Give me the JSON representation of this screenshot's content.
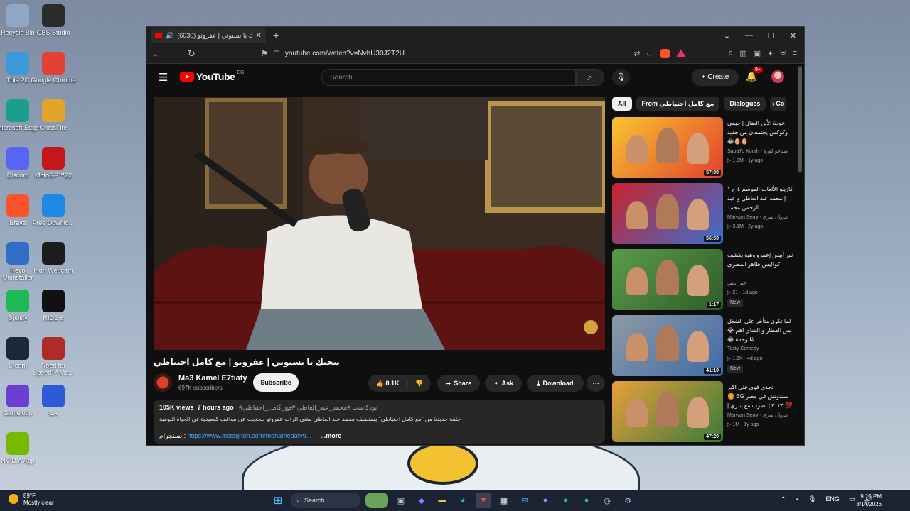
{
  "desktop": {
    "icons": [
      {
        "label": "Recycle Bin",
        "icon": "recycle-bin-icon",
        "color": "#8fa6c4"
      },
      {
        "label": "OBS Studio",
        "icon": "obs-icon",
        "color": "#2b2b2b"
      },
      {
        "label": "This PC",
        "icon": "pc-icon",
        "color": "#3a9ad9"
      },
      {
        "label": "Google Chrome",
        "icon": "chrome-icon",
        "color": "#e34133"
      },
      {
        "label": "Microsoft Edge",
        "icon": "edge-icon",
        "color": "#1a9e8e"
      },
      {
        "label": "CrossFire",
        "icon": "crossfire-icon",
        "color": "#e2a52b"
      },
      {
        "label": "Discord",
        "icon": "discord-icon",
        "color": "#5865f2"
      },
      {
        "label": "MotoGP™22",
        "icon": "motogp-icon",
        "color": "#c5161c"
      },
      {
        "label": "Brave",
        "icon": "brave-icon",
        "color": "#fb542b"
      },
      {
        "label": "Free Downlo...",
        "icon": "free-download-icon",
        "color": "#1e88e5"
      },
      {
        "label": "Revo Uninstaller",
        "icon": "revo-icon",
        "color": "#2f6ec7"
      },
      {
        "label": "Iriun Webcam",
        "icon": "webcam-icon",
        "color": "#1d1d1d"
      },
      {
        "label": "Spotify",
        "icon": "spotify-icon",
        "color": "#1db954"
      },
      {
        "label": "RIDE 6",
        "icon": "ride6-icon",
        "color": "#111111"
      },
      {
        "label": "Steam",
        "icon": "steam-icon",
        "color": "#1b2838"
      },
      {
        "label": "Need for Speed™ Mo...",
        "icon": "nfs-icon",
        "color": "#b02a2a"
      },
      {
        "label": "Gameloop",
        "icon": "gameloop-icon",
        "color": "#6a3fd1"
      },
      {
        "label": "EA",
        "icon": "ea-icon",
        "color": "#2d5ad6"
      },
      {
        "label": "NVIDIA App",
        "icon": "nvidia-icon",
        "color": "#76b900"
      }
    ]
  },
  "browser": {
    "tab_title": "(6030) بتحبك يا بسيوني | عفروتو",
    "url": "youtube.com/watch?v=NvhU30J2T2U"
  },
  "youtube": {
    "logo": "YouTube",
    "country": "EG",
    "search_placeholder": "Search",
    "create_label": "Create",
    "notif_count": "9+",
    "video_title": "بتحبك يا بسيوني | عفروتو | مع كامل احتياطي",
    "channel_name": "Ma3 Kamel E7tiaty",
    "subscribers": "697K subscribers",
    "subscribe_label": "Subscribe",
    "likes": "8.1K",
    "share_label": "Share",
    "ask_label": "Ask",
    "download_label": "Download",
    "views": "105K views",
    "uploaded": "7 hours ago",
    "tags": "#بودكاست #محمد_عبد_العاطي #مع_كامل_احتياطي",
    "description_line": "حلقة جديدة من \"مع كامل احتياطي\" يستضيف محمد عبد العاطي مغني الراب عفروتو للحديث عن مواقف كوميدية في الحياة اليومية",
    "instagram_prefix": "إنستجرام:",
    "instagram_link": "https://www.instagram.com/mohamedaty9...",
    "more_label": "...more",
    "chips": [
      "All",
      "From مع كامل احتياطي",
      "Dialogues",
      "Co"
    ],
    "recommendations": [
      {
        "title": "عودة الأبن الضال | حيمي وكوكس يجتمعان من جديد 🥚🥚😂",
        "channel": "Saba7o Korah - صباحو كورة",
        "stats": "1.3M · 1y ago",
        "duration": "57:09",
        "new": "",
        "colors": [
          "#f7c531",
          "#e2402b"
        ]
      },
      {
        "title": "كازينو الألعاب الموسم ٤ ح ١ | محمد عبد العاطي و عبد الرحمن محمد",
        "channel": "Marwan Serry - مروان سري",
        "stats": "3.1M · 2y ago",
        "duration": "56:59",
        "new": "",
        "colors": [
          "#c8232c",
          "#3b6fd1"
        ]
      },
      {
        "title": "خبر أبيض |عمرو وهبة يكشف كواليس ظاهر المصري",
        "channel": "خبر أبيض",
        "stats": "21 · 1d ago",
        "duration": "1:17",
        "new": "New",
        "colors": [
          "#5a9b4a",
          "#2f5d2a"
        ]
      },
      {
        "title": "لما تكون متأخر علي الشغل بس الفطار و الشاي اهم 😂 #الوحدة 😂",
        "channel": "Tasty Comedy",
        "stats": "1.6K · 4d ago",
        "duration": "41:10",
        "new": "New",
        "colors": [
          "#8e9aa3",
          "#3e6aa8"
        ]
      },
      {
        "title": "تحدي فوي فلي اكبر سندوتش في مصر EG 🍔💯 ٢٠٢٥ | اضرب مع سري |",
        "channel": "Marwan Serry - مروان سري",
        "stats": "1M · 1y ago",
        "duration": "47:20",
        "new": "",
        "colors": [
          "#e8a03a",
          "#3a7a3a"
        ]
      }
    ]
  },
  "taskbar": {
    "temperature": "89°F",
    "weather": "Mostly clear",
    "search_label": "Search",
    "language": "ENG",
    "time": "9:15 PM",
    "date": "8/14/2026",
    "apps": [
      "start-icon",
      "explorer-icon",
      "edge-icon",
      "brave-icon",
      "store-icon",
      "mail-icon",
      "discord-icon",
      "spotify-icon",
      "whatsapp-icon",
      "obs-icon",
      "steam-icon"
    ]
  }
}
